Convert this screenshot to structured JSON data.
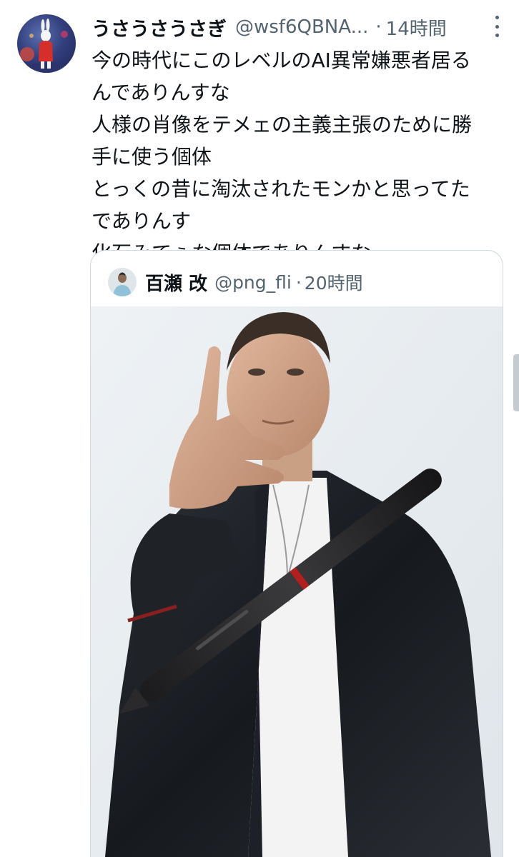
{
  "tweet": {
    "display_name": "うさうさうさぎ",
    "handle": "@wsf6QBNA...",
    "separator": "·",
    "time": "14時間",
    "body_lines": [
      "今の時代にこのレベルのAI異常嫌悪者居る",
      "んでありんすな",
      "人様の肖像をテメェの主義主張のために勝",
      "手に使う個体",
      "とっくの昔に淘汰されたモンかと思ってた",
      "でありんす",
      "化石みてぇな個体でありんすな"
    ],
    "avatar_icon": "rabbit-avatar",
    "more_icon": "more-dots-icon"
  },
  "quoted_tweet": {
    "display_name": "百瀬 改",
    "handle": "@png_fli",
    "separator": "·",
    "time": "20時間",
    "avatar_icon": "person-avatar",
    "image_subject": "photo-man-leather-jacket-with-stylus-pen"
  },
  "colors": {
    "text_primary": "#0f1419",
    "text_secondary": "#536471",
    "border": "#cfd9de",
    "background": "#ffffff"
  }
}
